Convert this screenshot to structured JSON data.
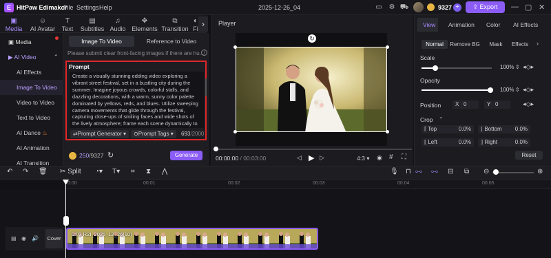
{
  "app": {
    "name": "HitPaw Edimakor",
    "doc_title": "2025-12-26_04",
    "credits": "9327",
    "export_label": "Export"
  },
  "menu": [
    "File",
    "Settings",
    "Help"
  ],
  "left_tabs": [
    {
      "label": "Media",
      "icon": "media-icon"
    },
    {
      "label": "AI Avatar",
      "icon": "avatar-icon"
    },
    {
      "label": "Text",
      "icon": "text-icon"
    },
    {
      "label": "Subtitles",
      "icon": "subtitles-icon"
    },
    {
      "label": "Audio",
      "icon": "audio-icon"
    },
    {
      "label": "Elements",
      "icon": "elements-icon"
    },
    {
      "label": "Transition",
      "icon": "transition-icon"
    },
    {
      "label": "Fi",
      "icon": "filter-icon"
    }
  ],
  "sidebar": {
    "media": "Media",
    "ai_video": "AI Video",
    "items": [
      "AI Effects",
      "Image To Video",
      "Video to Video",
      "Text to Video",
      "AI Dance",
      "AI Animation",
      "AI Transition"
    ]
  },
  "panel": {
    "seg_image": "Image To Video",
    "seg_ref": "Reference to Video",
    "notice": "Please submit clear front-facing images if there are hu...",
    "prompt_title": "Prompt",
    "prompt_text": "Create a visually stunning edding video exploring a vibrant street festival, set in a bustling city during the summer. Imagine joyous crowds, colorful stalls, and dazzling decorations, with a warm, sunny color palette dominated by yellows, reds, and blues. Utilize sweeping camera movements that glide through the festival, capturing close-ups of smiling faces and wide shots of the lively atmosphere; frame each scene dynamically to",
    "prompt_generator": "Prompt Generator",
    "prompt_tags": "Prompt Tags",
    "count": "693",
    "count_max": "/2000",
    "cost": "250",
    "cost_total": "/9327",
    "generate": "Generate"
  },
  "player": {
    "title": "Player",
    "time_current": "00:00:00",
    "time_total": "/ 00:03:00",
    "ratio": "4:3"
  },
  "right": {
    "tabs": [
      "View",
      "Animation",
      "Color",
      "AI Effects"
    ],
    "subtabs": [
      "Normal",
      "Remove BG",
      "Mask",
      "Effects"
    ],
    "scale_label": "Scale",
    "scale_val": "100%",
    "opacity_label": "Opacity",
    "opacity_val": "100%",
    "position_label": "Position",
    "pos_x_label": "X",
    "pos_x": "0",
    "pos_y_label": "Y",
    "pos_y": "0",
    "crop_label": "Crop",
    "top_label": "Top",
    "top_val": "0.0%",
    "bottom_label": "Bottom",
    "bottom_val": "0.0%",
    "left_label": "Left",
    "left_val": "0.0%",
    "right_label": "Right",
    "right_val": "0.0%",
    "reset": "Reset",
    "scale_level": 1.0,
    "opacity_level": 1.0
  },
  "timeline": {
    "split": "Split",
    "ruler": [
      "0:00",
      "00:01",
      "00:02",
      "00:03",
      "00:04",
      "00:05"
    ],
    "cover": "Cover",
    "clip_label": "0:03 R2I_2025_12_26(10)"
  },
  "colors": {
    "accent": "#8b5cf6",
    "highlight": "#e0272a",
    "coin": "#e8b642"
  }
}
